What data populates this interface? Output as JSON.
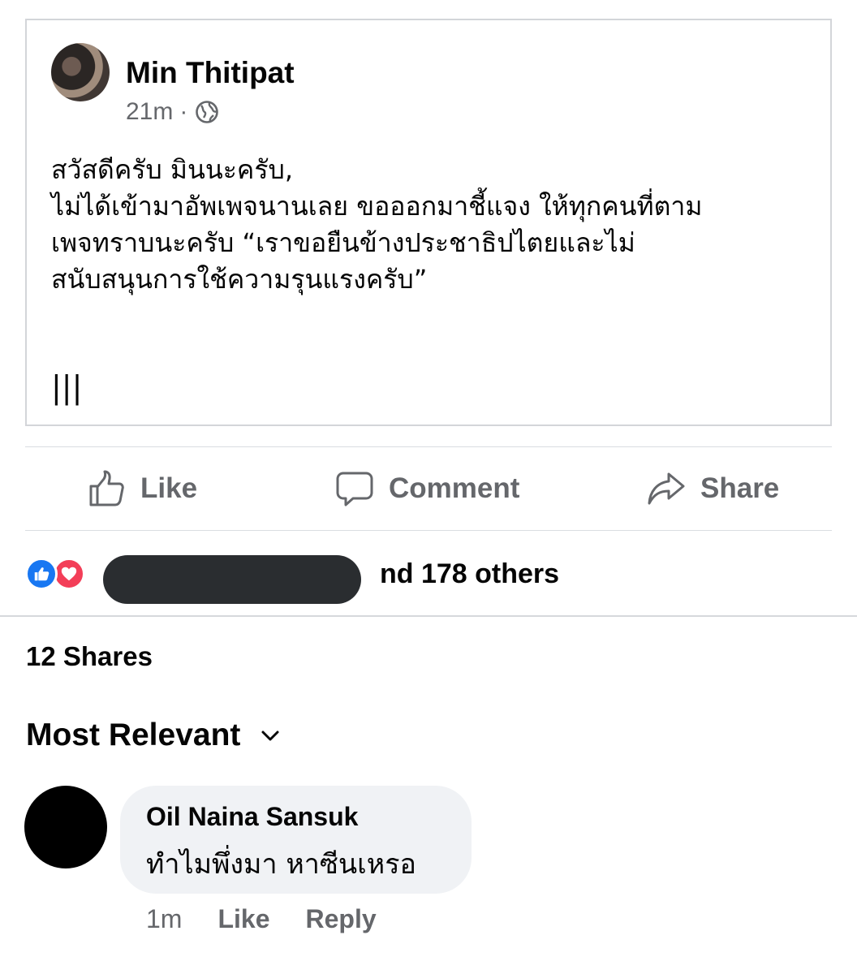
{
  "post": {
    "author": "Min Thitipat",
    "time": "21m",
    "separator": "·",
    "privacy_icon": "globe-icon",
    "body_lines": [
      "สวัสดีครับ มินนะครับ,",
      "ไม่ได้เข้ามาอัพเพจนานเลย ขอออกมาชี้แจง ให้ทุกคนที่ตาม",
      "เพจทราบนะครับ “เราขอยืนข้างประชาธิปไตยและไม่",
      "สนับสนุนการใช้ความรุนแรงครับ”"
    ],
    "tail": "|||"
  },
  "actions": {
    "like": "Like",
    "comment": "Comment",
    "share": "Share"
  },
  "reactions": {
    "text": "nd 178 others",
    "icons": [
      "like-reaction-icon",
      "love-reaction-icon"
    ]
  },
  "shares": "12 Shares",
  "sort": {
    "label": "Most Relevant"
  },
  "comment": {
    "author": "Oil Naina Sansuk",
    "text": "ทำไมพึ่งมา หาซีนเหรอ",
    "time": "1m",
    "like": "Like",
    "reply": "Reply"
  },
  "colors": {
    "text": "#050505",
    "secondary": "#65676b",
    "like_blue": "#1877f2",
    "love_red": "#f33e58",
    "bubble": "#f0f2f5"
  }
}
